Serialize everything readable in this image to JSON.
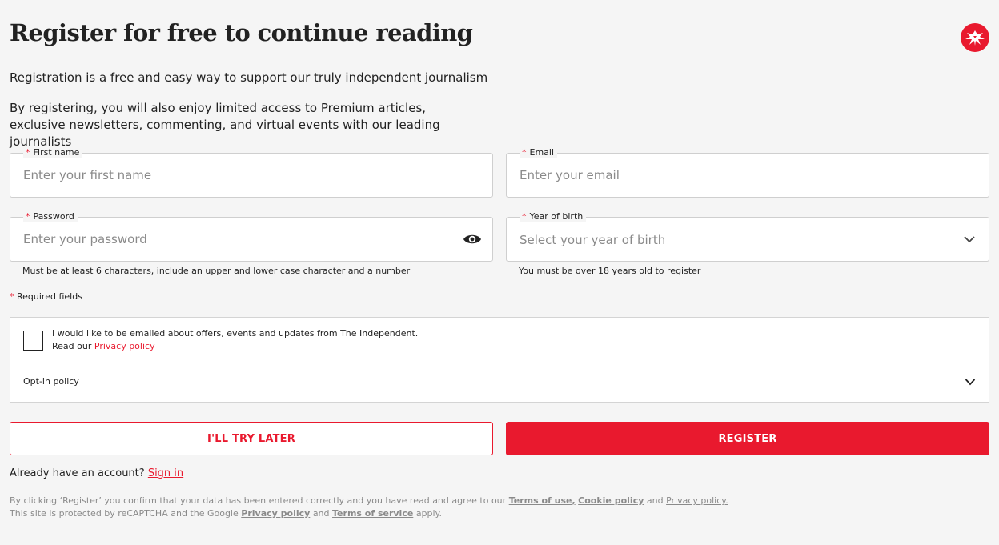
{
  "header": {
    "title": "Register for free to continue reading",
    "logo_icon": "independent-eagle-icon",
    "brand_color": "#e9192e"
  },
  "intro": {
    "line1": "Registration is a free and easy way to support our truly independent journalism",
    "line2": "By registering, you will also enjoy limited access to Premium articles, exclusive newsletters, commenting, and virtual events with our leading journalists"
  },
  "form": {
    "required_marker": "*",
    "first_name": {
      "label": "First name",
      "placeholder": "Enter your first name",
      "value": ""
    },
    "email": {
      "label": "Email",
      "placeholder": "Enter your email",
      "value": ""
    },
    "password": {
      "label": "Password",
      "placeholder": "Enter your password",
      "value": "",
      "hint": "Must be at least 6 characters, include an upper and lower case character and a number",
      "toggle_icon": "eye-icon"
    },
    "year_of_birth": {
      "label": "Year of birth",
      "selected": "Select your year of birth",
      "hint": "You must be over 18 years old to register",
      "icon": "chevron-down-icon"
    },
    "required_fields_note": "Required fields"
  },
  "optin": {
    "text_line1": "I would like to be emailed about offers, events and updates from The Independent.",
    "text_line2_prefix": "Read our",
    "privacy_link": "Privacy policy",
    "policy_toggle": "Opt-in policy",
    "checked": false
  },
  "buttons": {
    "later": "I'LL TRY LATER",
    "register": "REGISTER"
  },
  "signin": {
    "prefix": "Already have an account?",
    "link": "Sign in"
  },
  "legal": {
    "line1_prefix": "By clicking ‘Register’ you confirm that your data has been entered correctly and you have read and agree to our",
    "terms_of_use": "Terms of use,",
    "cookie_policy": "Cookie policy",
    "and1": "and",
    "privacy_policy": "Privacy policy.",
    "line2_prefix": "This site is protected by reCAPTCHA and the Google",
    "google_privacy": "Privacy policy",
    "and2": "and",
    "terms_of_service": "Terms of service",
    "apply": "apply."
  }
}
